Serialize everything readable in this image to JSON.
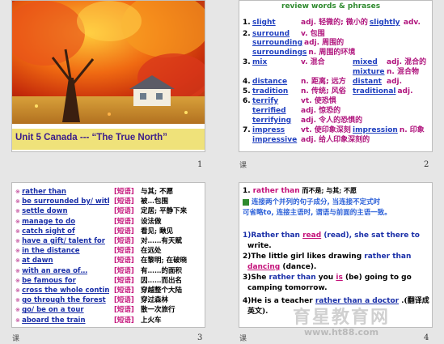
{
  "slide1": {
    "title": "Unit 5  Canada --- “The True North”",
    "page": "1"
  },
  "slide2": {
    "heading": "review words & phrases",
    "page": "2",
    "corner": "课",
    "lines": [
      {
        "n": "1.",
        "a": "slight",
        "b": "adj. 轻微的; 微小的",
        "c": "slightly",
        "d": "adv."
      },
      {
        "n": "2.",
        "a": "surround",
        "b": "v. 包围"
      },
      {
        "n": "",
        "a": "surrounding",
        "b": "adj. 周围的"
      },
      {
        "n": "",
        "a": "surroundings",
        "b": "n. 周围的环境"
      },
      {
        "n": "3.",
        "a": "mix",
        "b": "v. 混合",
        "c": "mixed",
        "d": "adj. 混合的"
      },
      {
        "n": "",
        "a": "",
        "b": "",
        "c": "mixture",
        "d": "n. 混合物"
      },
      {
        "n": "4.",
        "a": "distance",
        "b": "n. 距离; 远方",
        "c": "distant",
        "d": "adj."
      },
      {
        "n": "5.",
        "a": "tradition",
        "b": "n. 传统; 风俗",
        "c": "traditional",
        "d": "adj."
      },
      {
        "n": "6.",
        "a": "terrify",
        "b": "vt. 使恐惧"
      },
      {
        "n": "",
        "a": "terrified",
        "b": "adj. 惊恐的"
      },
      {
        "n": "",
        "a": "terrifying",
        "b": "adj. 令人的恐惧的"
      },
      {
        "n": "7.",
        "a": "impress",
        "b": "vt. 使印象深刻",
        "c": "impression",
        "d": "n. 印象"
      },
      {
        "n": "",
        "a": "impressive",
        "b": "adj. 给人印象深刻的"
      }
    ]
  },
  "slide3": {
    "page": "3",
    "corner": "课",
    "tag": "[短语]",
    "items": [
      {
        "p": "rather than",
        "m": "与其; 不愿"
      },
      {
        "p": "be surrounded by/ with",
        "m": "被…包围"
      },
      {
        "p": "settle down",
        "m": "定居; 平静下来"
      },
      {
        "p": "manage to do",
        "m": "设法做"
      },
      {
        "p": "catch sight of",
        "m": "看见; 瞅见"
      },
      {
        "p": "have a gift/ talent for",
        "m": "对……有天赋"
      },
      {
        "p": "in the distance",
        "m": "在远处"
      },
      {
        "p": "at dawn",
        "m": "在黎明; 在破晓"
      },
      {
        "p": "with an area of…",
        "m": "有……的面积"
      },
      {
        "p": "be famous for",
        "m": "因……而出名"
      },
      {
        "p": "cross the whole continent",
        "m": "穿越整个大陆"
      },
      {
        "p": "go through the forest",
        "m": "穿过森林"
      },
      {
        "p": "go/ be on a tour",
        "m": "散一次旅行"
      },
      {
        "p": "aboard the train",
        "m": "上火车"
      }
    ]
  },
  "slide4": {
    "page": "4",
    "corner": "课",
    "head_num": "1.",
    "head_phrase": "rather than",
    "head_mean": "而不是; 与其; 不愿",
    "note": "连接两个并列的句子成分, 当连接不定式时",
    "note2": "可省略to, 连接主语时, 谓语与前面的主语一致。",
    "ex1a": "1)Rather than",
    "ex1ans": "read",
    "ex1b": "(read), she sat there to",
    "ex1c": "write.",
    "ex2a": "2)The little girl likes drawing",
    "ex2phr": "rather than",
    "ex2ans": "dancing",
    "ex2b": "(dance).",
    "ex3a": "3)She",
    "ex3phr": "rather than",
    "ex3mid": "you",
    "ex3ans": "is",
    "ex3b": "(be) going to go",
    "ex3c": "camping tomorrow.",
    "ex4a": "4)He is a teacher",
    "ex4phr": "rather than a doctor",
    "ex4b": ".(翻译成",
    "ex4c": "英文)."
  },
  "watermark": {
    "brand": "育星教育网",
    "url": "www.ht88.com"
  }
}
